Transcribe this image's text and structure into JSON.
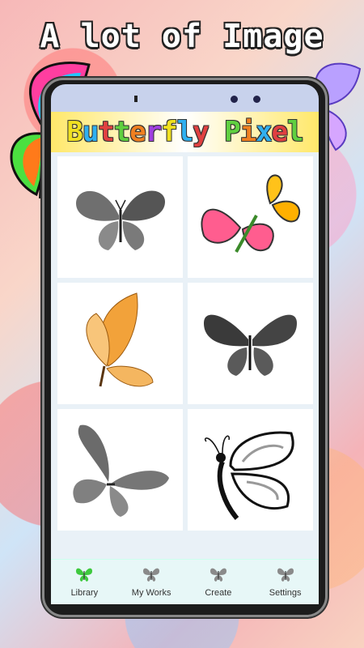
{
  "headline": "A lot of Image",
  "app": {
    "title_letters": [
      {
        "ch": "B",
        "color": "#f0e020"
      },
      {
        "ch": "u",
        "color": "#30b0f0"
      },
      {
        "ch": "t",
        "color": "#e04040"
      },
      {
        "ch": "t",
        "color": "#60d040"
      },
      {
        "ch": "e",
        "color": "#f08020"
      },
      {
        "ch": "r",
        "color": "#a040e0"
      },
      {
        "ch": "f",
        "color": "#f0e020"
      },
      {
        "ch": "l",
        "color": "#30b0f0"
      },
      {
        "ch": "y",
        "color": "#e04040"
      },
      {
        "ch": " ",
        "color": "#000"
      },
      {
        "ch": "P",
        "color": "#60d040"
      },
      {
        "ch": "i",
        "color": "#f08020"
      },
      {
        "ch": "x",
        "color": "#30b0f0"
      },
      {
        "ch": "e",
        "color": "#e04040"
      },
      {
        "ch": "l",
        "color": "#60d040"
      }
    ]
  },
  "gallery": [
    {
      "name": "gray-butterfly"
    },
    {
      "name": "pink-orange-butterflies"
    },
    {
      "name": "orange-butterfly"
    },
    {
      "name": "dark-gray-butterfly"
    },
    {
      "name": "gray-side-butterfly"
    },
    {
      "name": "black-white-butterfly"
    }
  ],
  "nav": [
    {
      "label": "Library",
      "icon": "butterfly-icon",
      "active": true
    },
    {
      "label": "My Works",
      "icon": "butterfly-icon",
      "active": false
    },
    {
      "label": "Create",
      "icon": "butterfly-icon",
      "active": false
    },
    {
      "label": "Settings",
      "icon": "butterfly-icon",
      "active": false
    }
  ],
  "colors": {
    "active_icon": "#3ec93e",
    "inactive_icon": "#8a8a8a",
    "nav_bg": "#e7f7f7"
  }
}
